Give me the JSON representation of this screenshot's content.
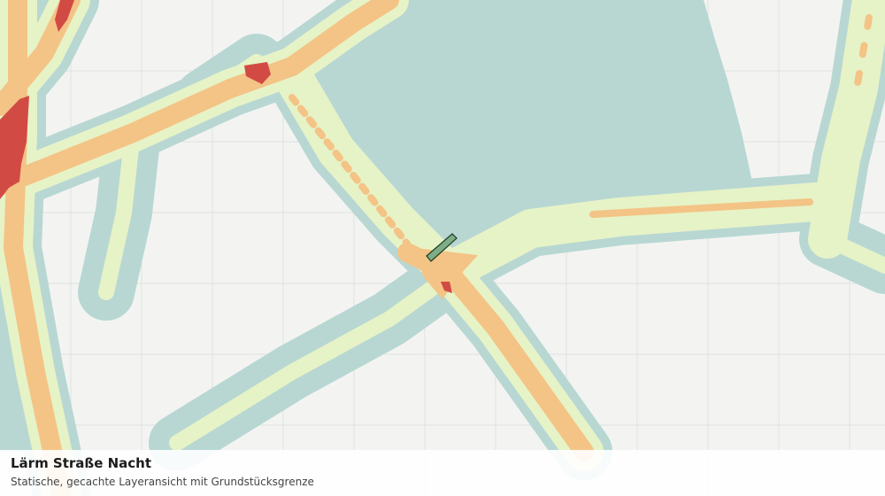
{
  "map": {
    "layer_title": "Lärm Straße Nacht",
    "layer_subtitle": "Statische, gecachte Layeransicht mit Grundstücksgrenze",
    "colors": {
      "background": "#f3f4f2",
      "grid": "#dfe2df",
      "noise_outer": "#b8d7d3",
      "noise_low": "#e6f3c6",
      "noise_mid": "#f4c386",
      "noise_high": "#d24a44",
      "parcel_fill": "#7fae86",
      "parcel_stroke": "#1f3d26"
    }
  }
}
